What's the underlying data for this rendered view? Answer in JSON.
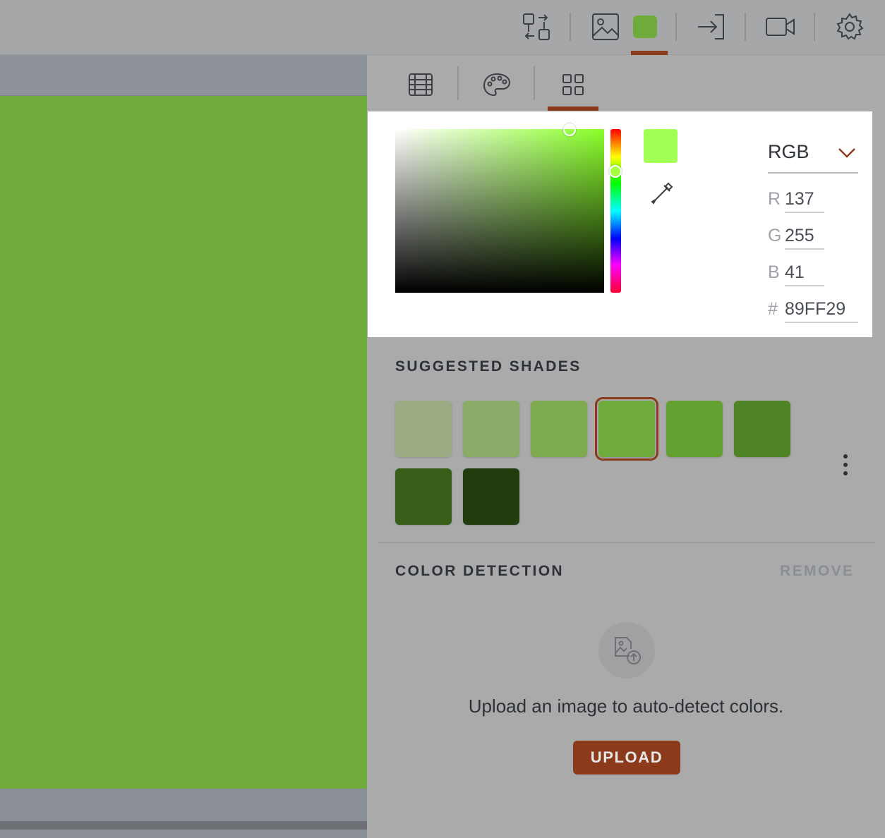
{
  "toolbar": {
    "icons": [
      "swap-layout-icon",
      "image-icon",
      "color-swatch-icon",
      "export-icon",
      "video-icon",
      "gear-icon"
    ],
    "active_color": "#6fab3a",
    "accent": "#8b3a1c"
  },
  "canvas": {
    "fill_color": "#6fab3a"
  },
  "panel": {
    "tabs": [
      "grid-table-icon",
      "palette-icon",
      "grid-icon"
    ],
    "active_tab": 2,
    "picker": {
      "preview_color": "#a2ff54",
      "mode": "RGB",
      "fields": [
        {
          "label": "R",
          "value": "137"
        },
        {
          "label": "G",
          "value": "255"
        },
        {
          "label": "B",
          "value": "41"
        },
        {
          "label": "#",
          "value": "89FF29"
        }
      ]
    },
    "suggested_shades": {
      "title": "SUGGESTED SHADES",
      "colors": [
        "#9bac85",
        "#8aab68",
        "#7eab4f",
        "#6fab3a",
        "#63a231",
        "#4f8426",
        "#375e19",
        "#223e0f"
      ],
      "selected_index": 3
    },
    "color_detection": {
      "title": "COLOR DETECTION",
      "remove_label": "REMOVE",
      "message": "Upload an image to auto-detect colors.",
      "upload_label": "UPLOAD"
    }
  }
}
